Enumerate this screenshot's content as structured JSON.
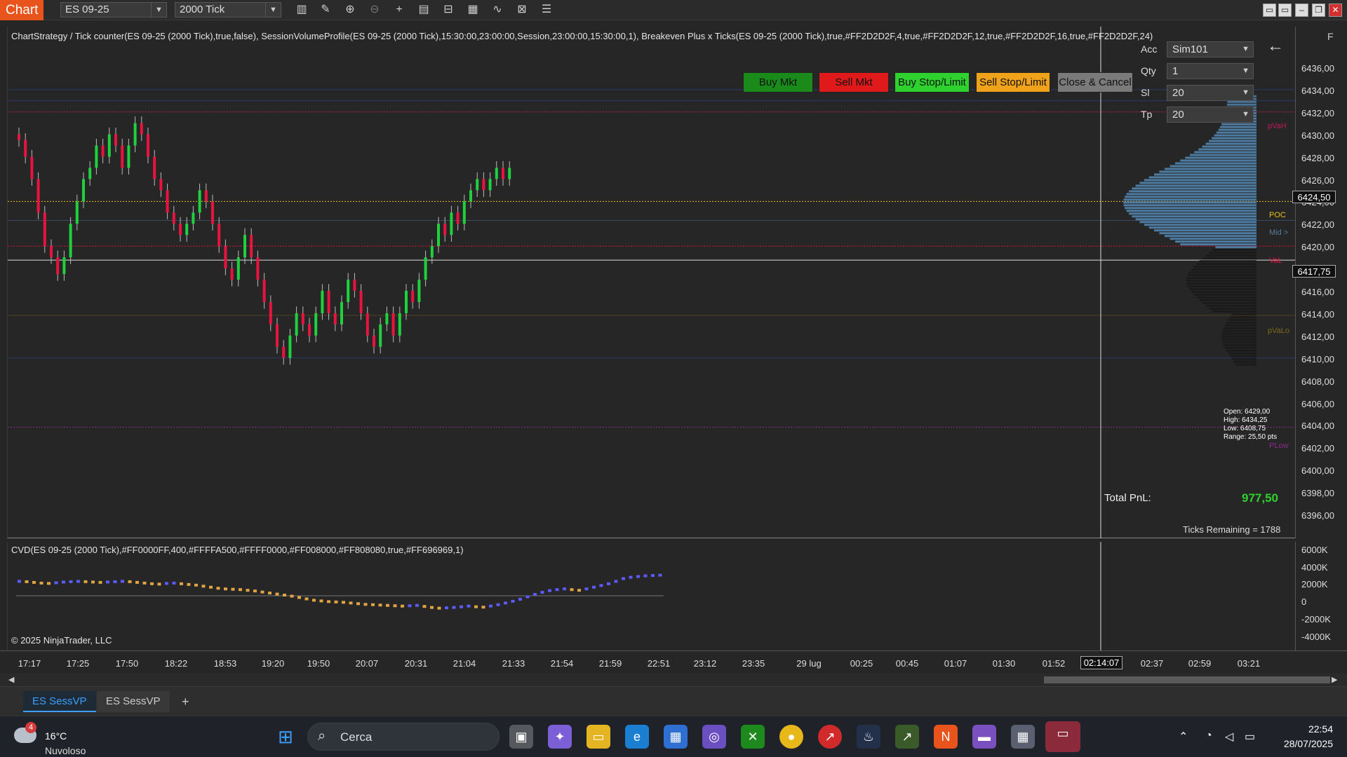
{
  "toolbar": {
    "app_title": "Chart",
    "instrument": "ES 09-25",
    "interval": "2000 Tick"
  },
  "chart": {
    "strategy_label": "ChartStrategy / Tick counter(ES 09-25 (2000 Tick),true,false), SessionVolumeProfile(ES 09-25 (2000 Tick),15:30:00,23:00:00,Session,23:00:00,15:30:00,1), Breakeven Plus x Ticks(ES 09-25 (2000 Tick),true,#FF2D2D2F,4,true,#FF2D2D2F,12,true,#FF2D2D2F,16,true,#FF2D2D2F,24)",
    "price_ticks": [
      "6436,00",
      "6434,00",
      "6432,00",
      "6430,00",
      "6428,00",
      "6426,00",
      "6424,00",
      "6422,00",
      "6420,00",
      "6418,00",
      "6416,00",
      "6414,00",
      "6412,00",
      "6410,00",
      "6408,00",
      "6406,00",
      "6404,00",
      "6402,00",
      "6400,00",
      "6398,00",
      "6396,00"
    ],
    "current_price_tag": "6424,50",
    "crosshair_price_tag": "6417,75",
    "colors": {
      "up": "#1fd13d",
      "down": "#e8133f",
      "poc": "#e6c21a",
      "vah": "#c2185b",
      "profile": "#4f7fa8",
      "background": "#262626"
    }
  },
  "order_panel": {
    "acc_label": "Acc",
    "acc_value": "Sim101",
    "qty_label": "Qty",
    "qty_value": "1",
    "sl_label": "Sl",
    "sl_value": "20",
    "tp_label": "Tp",
    "tp_value": "20",
    "buy_mkt": "Buy Mkt",
    "sell_mkt": "Sell Mkt",
    "buy_stop_limit": "Buy Stop/Limit",
    "sell_stop_limit": "Sell Stop/Limit",
    "close_cancel": "Close & Cancel",
    "f_button": "F"
  },
  "profile_labels": {
    "pvah": "pVaH",
    "poc": "POC",
    "mid": "Mid >",
    "val": "VaL",
    "pval": "pVaLo",
    "plow": "PLow"
  },
  "stats_box": {
    "open": "Open: 6429,00",
    "high": "High: 6434,25",
    "low": "Low: 6408,75",
    "range": "Range: 25,50 pts"
  },
  "pnl": {
    "label": "Total PnL:",
    "value": "977,50",
    "ticks_remaining": "Ticks Remaining = 1788"
  },
  "cvd": {
    "label": "CVD(ES 09-25 (2000 Tick),#FF0000FF,400,#FFFFA500,#FFFF0000,#FF008000,#FF808080,true,#FF696969,1)",
    "copyright": "© 2025 NinjaTrader, LLC",
    "ticks": [
      "6000K",
      "4000K",
      "2000K",
      "0",
      "-2000K",
      "-4000K"
    ]
  },
  "time_axis": {
    "ticks": [
      "17:17",
      "17:25",
      "17:50",
      "18:22",
      "18:53",
      "19:20",
      "19:50",
      "20:07",
      "20:31",
      "21:04",
      "21:33",
      "21:54",
      "21:59",
      "22:51",
      "23:12",
      "23:35",
      "29 lug",
      "00:25",
      "00:45",
      "01:07",
      "01:30",
      "01:52",
      "02:37",
      "02:59",
      "03:21"
    ],
    "crosshair_time": "02:14:07"
  },
  "tabs": {
    "tab1": "ES SessVP",
    "tab2": "ES SessVP",
    "add": "+"
  },
  "taskbar": {
    "weather_badge": "4",
    "temperature": "16°C",
    "weather_desc": "Nuvoloso",
    "search_placeholder": "Cerca",
    "time": "22:54",
    "date": "28/07/2025"
  }
}
